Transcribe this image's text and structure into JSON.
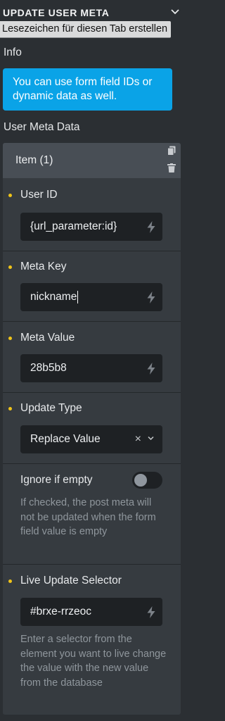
{
  "header": {
    "title": "UPDATE USER META",
    "tooltip": "Lesezeichen für diesen Tab erstellen"
  },
  "info": {
    "label": "Info",
    "message": "You can use form field IDs or dynamic data as well."
  },
  "user_meta_data": {
    "label": "User Meta Data",
    "item_title": "Item (1)",
    "user_id": {
      "label": "User ID",
      "value": "{url_parameter:id}"
    },
    "meta_key": {
      "label": "Meta Key",
      "value": "nickname"
    },
    "meta_value": {
      "label": "Meta Value",
      "value": "28b5b8"
    },
    "update_type": {
      "label": "Update Type",
      "selected": "Replace Value",
      "clear_glyph": "×"
    },
    "ignore_if_empty": {
      "label": "Ignore if empty",
      "checked": false,
      "description": "If checked, the post meta will not be updated when the form field value is empty"
    },
    "live_update_selector": {
      "label": "Live Update Selector",
      "value": "#brxe-rrzeoc",
      "description": "Enter a selector from the element you want to live change the value with the new value from the database"
    }
  },
  "colors": {
    "accent_info": "#0aa3e7",
    "indicator_dot": "#f0c419",
    "panel_bg": "#2b2f33"
  },
  "icons": [
    "chevron-down-icon",
    "copy-icon",
    "trash-icon",
    "bolt-icon"
  ]
}
